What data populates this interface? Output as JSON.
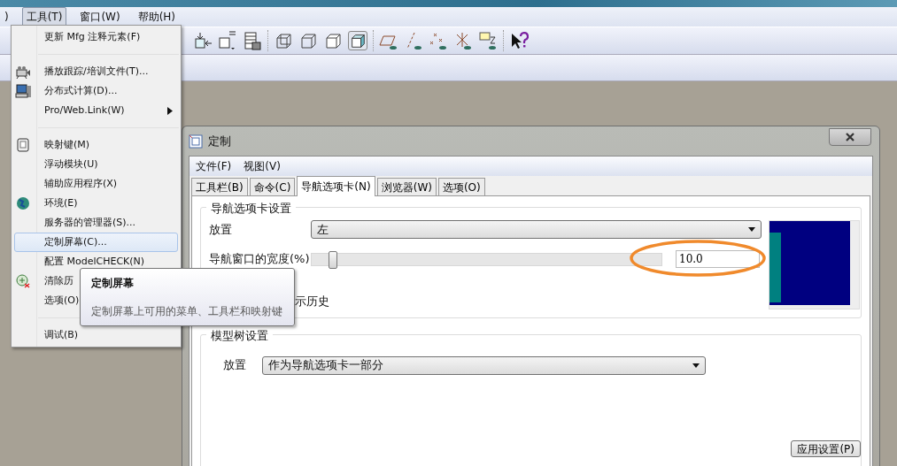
{
  "menubar": [
    {
      "label": ")",
      "selected": false
    },
    {
      "label": "工具(T)",
      "selected": true
    },
    {
      "label": "窗口(W)",
      "selected": false
    },
    {
      "label": "帮助(H)",
      "selected": false
    }
  ],
  "tools_menu": [
    {
      "kind": "item",
      "label": "更新 Mfg 注释元素(F)",
      "highlighted": false
    },
    {
      "kind": "separator"
    },
    {
      "kind": "item",
      "label": "播放跟踪/培训文件(T)...",
      "highlighted": false
    },
    {
      "kind": "item",
      "label": "分布式计算(D)...",
      "highlighted": false
    },
    {
      "kind": "submenu",
      "label": "Pro/Web.Link(W)",
      "highlighted": false
    },
    {
      "kind": "separator"
    },
    {
      "kind": "item",
      "label": "映射键(M)",
      "highlighted": false
    },
    {
      "kind": "item",
      "label": "浮动模块(U)",
      "highlighted": false
    },
    {
      "kind": "item",
      "label": "辅助应用程序(X)",
      "highlighted": false
    },
    {
      "kind": "item",
      "label": "环境(E)",
      "highlighted": false
    },
    {
      "kind": "item",
      "label": "服务器的管理器(S)...",
      "highlighted": false
    },
    {
      "kind": "item",
      "label": "定制屏幕(C)...",
      "highlighted": true
    },
    {
      "kind": "item",
      "label": "配置 ModelCHECK(N)",
      "highlighted": false
    },
    {
      "kind": "item",
      "label": "清除历",
      "highlighted": false
    },
    {
      "kind": "item",
      "label": "选项(O)",
      "highlighted": false
    },
    {
      "kind": "separator"
    },
    {
      "kind": "item",
      "label": "调试(B)",
      "highlighted": false
    }
  ],
  "tooltip": {
    "title": "定制屏幕",
    "text": "定制屏幕上可用的菜单、工具栏和映射键"
  },
  "dialog": {
    "title": "定制",
    "menu": [
      "文件(F)",
      "视图(V)"
    ],
    "tabs": [
      {
        "label": "工具栏(B)",
        "selected": false
      },
      {
        "label": "命令(C)",
        "selected": false
      },
      {
        "label": "导航选项卡(N)",
        "selected": true
      },
      {
        "label": "浏览器(W)",
        "selected": false
      },
      {
        "label": "选项(O)",
        "selected": false
      }
    ],
    "nav_tab_settings": {
      "legend": "导航选项卡设置",
      "placement_label": "放置",
      "placement_value": "左",
      "width_label": "导航窗口的宽度(%)",
      "width_slider": {
        "level": 0.05
      },
      "width_value": "10.0",
      "history_label": "示历史"
    },
    "model_tree_settings": {
      "legend": "模型树设置",
      "placement_label": "放置",
      "placement_value": "作为导航选项卡一部分"
    },
    "apply_button": "应用设置(P)"
  }
}
